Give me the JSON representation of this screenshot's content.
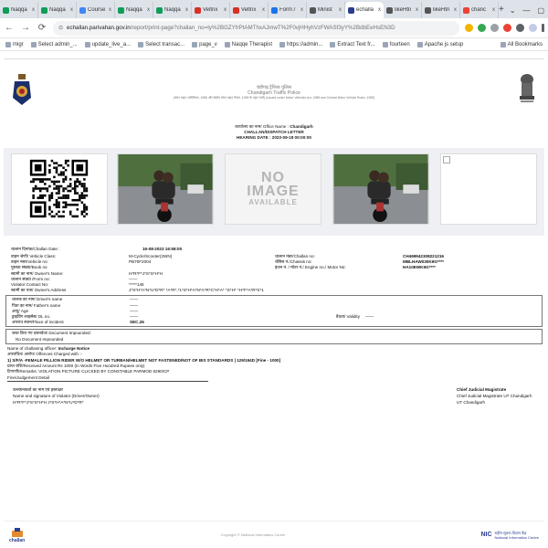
{
  "browser": {
    "tabs": [
      {
        "label": "Naqqa",
        "color": "#0f9d58"
      },
      {
        "label": "Naqqa",
        "color": "#0f9d58"
      },
      {
        "label": "Course",
        "color": "#4285f4"
      },
      {
        "label": "Naqqa",
        "color": "#0f9d58"
      },
      {
        "label": "Naqqa",
        "color": "#0f9d58"
      },
      {
        "label": "Veltrix",
        "color": "#d93025"
      },
      {
        "label": "Veltrix",
        "color": "#d93025"
      },
      {
        "label": "Form /",
        "color": "#1a73e8"
      },
      {
        "label": "Minist",
        "color": "#555555"
      },
      {
        "label": "echalla",
        "color": "#2a3d8f",
        "active": true
      },
      {
        "label": "likeHtn",
        "color": "#555555"
      },
      {
        "label": "likeHtn",
        "color": "#555555"
      },
      {
        "label": "chanc",
        "color": "#ea4335"
      }
    ],
    "new_tab": "+",
    "tab_close": "x",
    "window_controls": [
      "⌄",
      "—",
      "▢",
      "✕"
    ],
    "nav": {
      "back": "←",
      "forward": "→",
      "reload": "⟳"
    },
    "url_host": "echallan.parivahan.gov.in",
    "url_path": "/report/print-page?challan_no=ty%2BGZYfrPtAMThxAJmwT%2F0vjHHyhVzFWASf3yY%2BdbEeHsEN3D",
    "bookmarks": [
      "migr",
      "Select admin_...",
      "update_live_a...",
      "Select transac...",
      "page_v",
      "Naqqe Therapist",
      "https://admin...",
      "Extract Text fr...",
      "fourteen",
      "Apache js setup"
    ],
    "all_bookmarks": "All Bookmarks"
  },
  "header": {
    "title_hindi": "चंडीगढ़ ट्रैफिक पुलिस",
    "title_en": "Chandigarh Traffic Police",
    "subtitle": "(मोटर वाहन अधिनियम, 1988 और केंद्रीय मोटर वाहन नियम, 1989 के तहत जारी) (Issued under Motor Vehicles Act, 1988 and Central Motor Vehicle Rules, 1989)",
    "office_label": "कार्यालय का नाम/ Office Name :",
    "office_value": "Chandigarh",
    "letter_label": "CHALLAN/DISPATCH LETTER",
    "hearing_label": "HEARING DATE :",
    "hearing_value": "2023-09-18 00:00:00"
  },
  "images": {
    "no_image_line1": "NO",
    "no_image_line2": "IMAGE",
    "no_image_line3": "AVAILABLE"
  },
  "challan": {
    "date_label": "चालान दिनांक/Challan Date :",
    "date_value": "16-08-2023 16:58:00",
    "rows": [
      {
        "l1": "वाहन श्रेणी/ Vehicle Class:",
        "v1": "M-Cycle/Scooter(2WN)",
        "l2": "चालान नंबर/Challan no:",
        "v2": "CH469942308221216"
      },
      {
        "l1": "वाहन नंबर/Vehicle no:",
        "v1": "PB70F2004",
        "l2": "चेसिस नं./Chassis no:",
        "v2": "MBLHAW030K9G****"
      },
      {
        "l1": "पुस्तक संख्या/Book no",
        "v1": "",
        "l2": "इंजन नं. / मोटर नं./ Engine no./ Motor No:",
        "v2": "HA10EWK9G****"
      },
      {
        "l1": "स्वामी का नाम/ Owner's Name:",
        "v1": "H*R*F*J*S*S*H*H",
        "l2": "",
        "v2": ""
      },
      {
        "l1": "चालान संख्या /Form no:",
        "v1": "——",
        "l2": "",
        "v2": ""
      },
      {
        "l1": "Violator Contact No:",
        "v1": "*****145",
        "l2": "",
        "v2": ""
      },
      {
        "l1": "स्वामी का पता/ Owner's Address",
        "v1": "J*S*H*A*N*U*D*R* *A*R*,*1*S*H*A*N*A*R*C*H*A* *S*H* *H*F*A*R*S*1",
        "l2": "",
        "v2": ""
      }
    ]
  },
  "driver": {
    "rows": [
      {
        "label": "चालक का नाम/ Driver's name",
        "value": "——"
      },
      {
        "label": "पिता का नाम/ Father's name",
        "value": "——"
      },
      {
        "label": "आयु/ Age",
        "value": "——"
      },
      {
        "label": "ड्राइविंग लाइसेंस/ DL no.",
        "value": "——",
        "label2": "वैधता/ Validity",
        "value2": "——"
      },
      {
        "label": "अपराध स्थान/Place of incident",
        "value": "SEC.26"
      }
    ]
  },
  "documents": {
    "label": "जब्त किए गए दस्तावेज/ Document Impounded:",
    "value": "No Document Impounded"
  },
  "offence": {
    "officer_label": "Name of challaning officer:",
    "officer_value": "Incharge Notice",
    "charged_label": "अपराधित/ आरोप/ Offences Charged with :-",
    "offence_text": "1) S/F/A -FEMALE PILLION RIDER W/O HELMET OR TURBAN/HELMET NOT FASTENED/NOT OF BIS STANDARDS | 129/194D [Fine - 1000]",
    "received_text": "प्राप्त राशि/Received Amount Rs 1000 (In Words Five Hundred Rupees only)",
    "remarks_text": "टिप्पणी/Remarks: VIOLATION PICTURE CLICKED BY CONSTABLE PARMOD 6290/CP",
    "fine_text": "Fine/Judgement Detail"
  },
  "signature": {
    "violator_hi": "उल्लंघनकर्ता का नाम एवं हस्ताक्षर",
    "violator_en": "Name and signature of Violator (Driver/Owner)",
    "violator_value": "H*R*F*J*S*S*H*H J*S*H*A*N*U*D*R*",
    "judge_title": "Chief Judicial Magistrate",
    "judge_line": "Chief Judicial Magistrate UT Chandigarh",
    "judge_place": "UT Chandigarh"
  },
  "footer": {
    "echallan_logo": "challan",
    "copyright": "Copyright © National Informatics Centre",
    "nic": "NIC",
    "nic_hi": "राष्ट्रीय सूचना-विज्ञान केंद्र",
    "nic_en": "National Informatics Centre"
  }
}
